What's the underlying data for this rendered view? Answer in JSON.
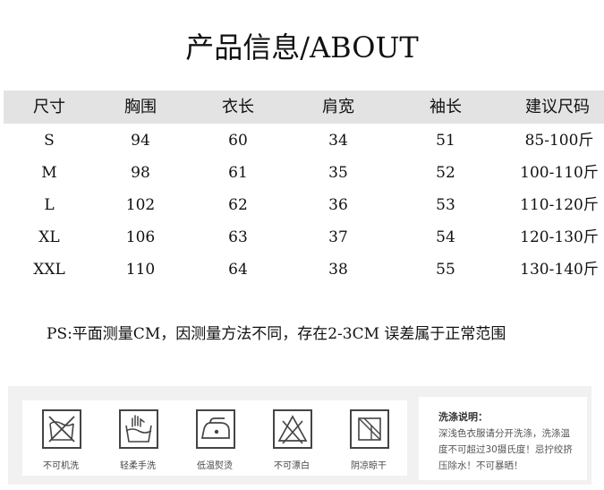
{
  "title": "产品信息/ABOUT",
  "table": {
    "headers": [
      "尺寸",
      "胸围",
      "衣长",
      "肩宽",
      "袖长",
      "建议尺码"
    ],
    "rows": [
      [
        "S",
        "94",
        "60",
        "34",
        "51",
        "85-100斤"
      ],
      [
        "M",
        "98",
        "61",
        "35",
        "52",
        "100-110斤"
      ],
      [
        "L",
        "102",
        "62",
        "36",
        "53",
        "110-120斤"
      ],
      [
        "XL",
        "106",
        "63",
        "37",
        "54",
        "120-130斤"
      ],
      [
        "XXL",
        "110",
        "64",
        "38",
        "55",
        "130-140斤"
      ]
    ]
  },
  "note": "PS:平面测量CM，因测量方法不同，存在2-3CM 误差属于正常范围",
  "care": {
    "items": [
      {
        "icon": "no-machine-wash-icon",
        "label": "不可机洗"
      },
      {
        "icon": "gentle-hand-wash-icon",
        "label": "轻柔手洗"
      },
      {
        "icon": "low-temp-iron-icon",
        "label": "低温熨烫"
      },
      {
        "icon": "no-bleach-icon",
        "label": "不可漂白"
      },
      {
        "icon": "shade-dry-icon",
        "label": "阴凉晾干"
      }
    ],
    "wash_title": "洗涤说明：",
    "wash_lines": [
      "深浅色衣服请分开洗涤，洗涤温",
      "度不可超过30摄氏度！忌拧绞挤",
      "压除水！不可暴晒！"
    ]
  }
}
